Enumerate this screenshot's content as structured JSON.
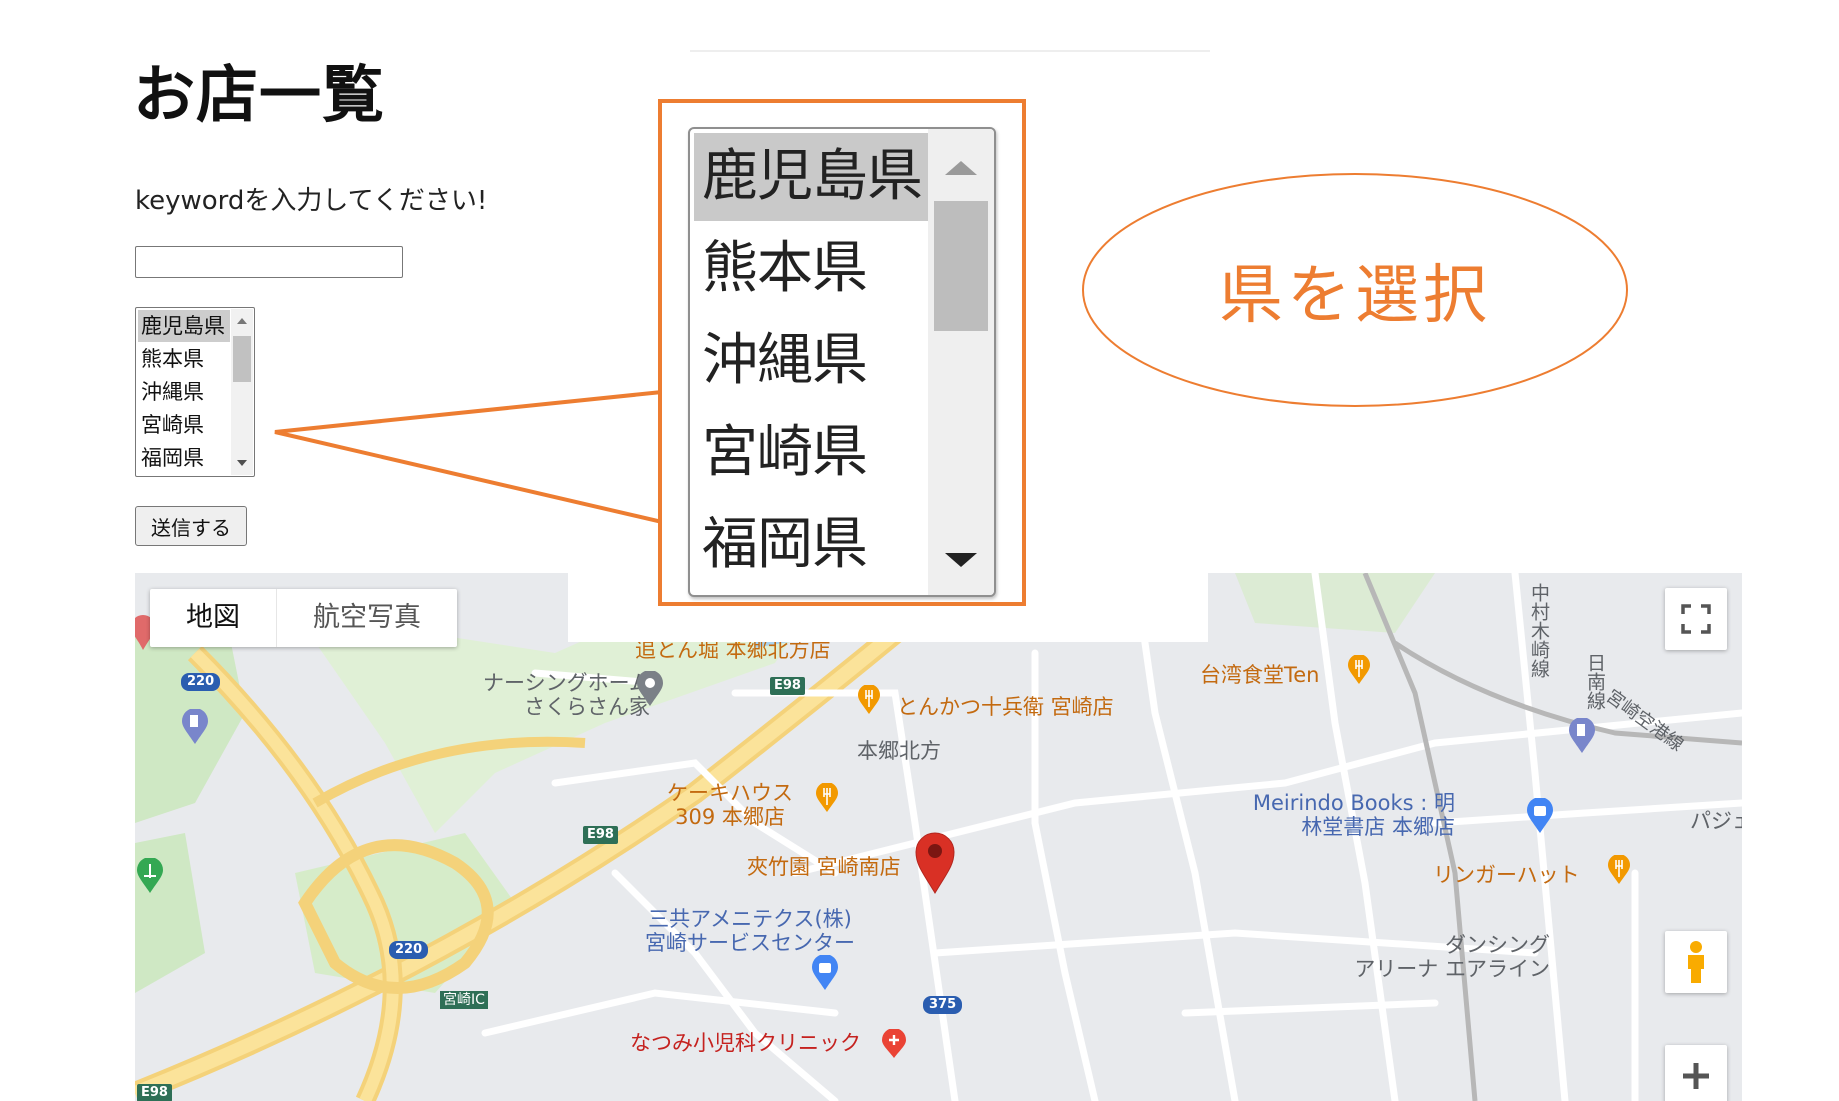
{
  "page": {
    "title": "お店一覧",
    "keyword_prompt": "keywordを入力してください!",
    "keyword_value": "",
    "submit_label": "送信する"
  },
  "prefecture_select": {
    "options": [
      "鹿児島県",
      "熊本県",
      "沖縄県",
      "宮崎県",
      "福岡県"
    ],
    "selected": "鹿児島県"
  },
  "annotation": {
    "label": "県を選択",
    "color": "#ed7d31"
  },
  "map": {
    "type_buttons": [
      "地図",
      "航空写真"
    ],
    "active_type": "地図",
    "labels": {
      "nursing_home": "ナーシングホーム\nさくらさん家",
      "oidonbori": "追とん堀 本郷北方店",
      "tonkatsu": "とんかつ十兵衛 宮崎店",
      "hongo_kitakata": "本郷北方",
      "cake_house": "ケーキハウス\n309 本郷店",
      "kyochikuen": "夾竹園 宮崎南店",
      "sankyo": "三共アメニテクス(株)\n宮崎サービスセンター",
      "natsumi": "なつみ小児科クリニック",
      "taiwan": "台湾食堂Ten",
      "meirindo": "Meirindo Books : 明\n林堂書店 本郷店",
      "ringer": "リンガーハット",
      "dancing": "ダンシング\nアリーナ エアライン",
      "pachi": "パジェ",
      "nakamura": "中村木崎線",
      "nichinan": "日南線",
      "airport_line": "宮崎空港線",
      "miyazaki_ic": "宮崎IC"
    },
    "shields": {
      "r220a": "220",
      "r220b": "220",
      "e98a": "E98",
      "e98b": "E98",
      "e98c": "E98",
      "r375": "375"
    },
    "icons": [
      "fullscreen-icon",
      "street-view-pegman-icon",
      "zoom-in-icon",
      "restaurant-icon",
      "gas-station-icon",
      "shopping-icon",
      "hospital-icon",
      "place-marker-icon"
    ]
  }
}
